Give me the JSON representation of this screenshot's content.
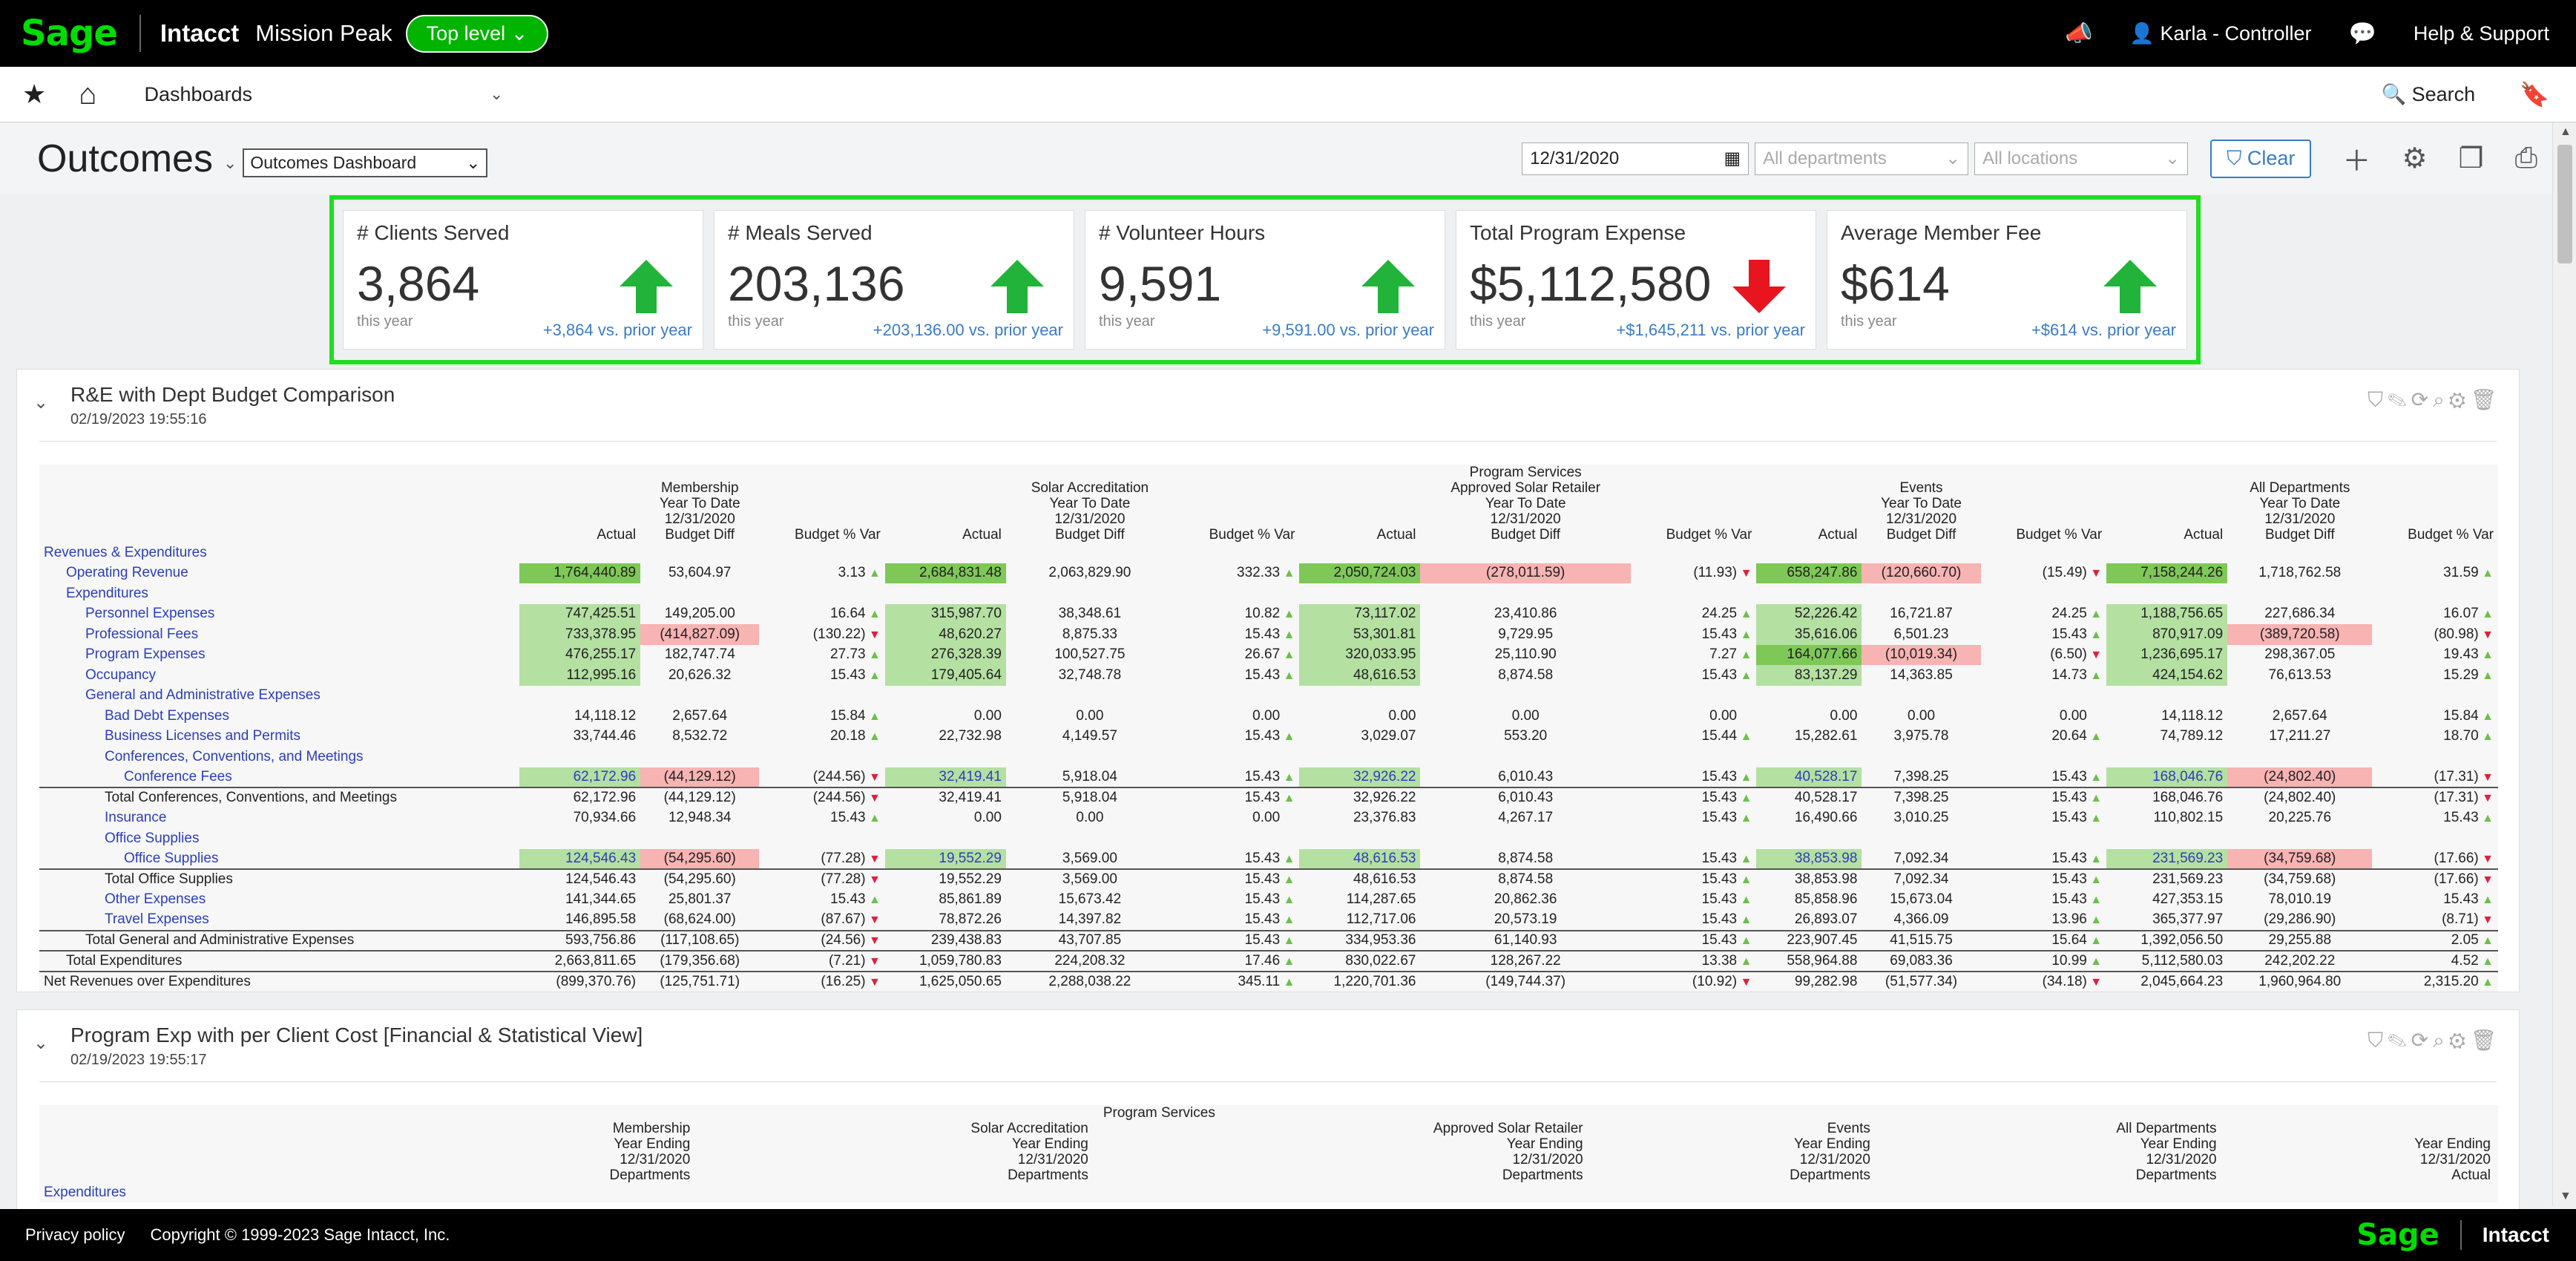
{
  "topbar": {
    "logo": "Sage",
    "brand": "Intacct",
    "company": "Mission Peak",
    "level": "Top level",
    "user": "Karla - Controller",
    "help": "Help & Support"
  },
  "navbar": {
    "menu": "Dashboards",
    "search": "Search"
  },
  "page": {
    "title": "Outcomes",
    "dashboard_select": "Outcomes Dashboard",
    "date": "12/31/2020",
    "departments_placeholder": "All departments",
    "locations_placeholder": "All locations",
    "clear": "Clear"
  },
  "kpis": [
    {
      "title": "# Clients Served",
      "value": "3,864",
      "sub": "this year",
      "change": "+3,864 vs. prior year",
      "trend": "up"
    },
    {
      "title": "# Meals Served",
      "value": "203,136",
      "sub": "this year",
      "change": "+203,136.00 vs. prior year",
      "trend": "up"
    },
    {
      "title": "# Volunteer Hours",
      "value": "9,591",
      "sub": "this year",
      "change": "+9,591.00 vs. prior year",
      "trend": "up"
    },
    {
      "title": "Total Program Expense",
      "value": "$5,112,580",
      "sub": "this year",
      "change": "+$1,645,211 vs. prior year",
      "trend": "down"
    },
    {
      "title": "Average Member Fee",
      "value": "$614",
      "sub": "this year",
      "change": "+$614 vs. prior year",
      "trend": "up"
    }
  ],
  "colors": {
    "up": "#22b33a",
    "down": "#e8141e",
    "highlight": "#22dd22",
    "link": "#3a7cc5"
  },
  "report1": {
    "title": "R&E with Dept Budget Comparison",
    "timestamp": "02/19/2023 19:55:16",
    "groups": [
      {
        "h": [
          "Membership",
          "Year To Date",
          "12/31/2020"
        ]
      },
      {
        "h": [
          "Solar Accreditation",
          "Year To Date",
          "12/31/2020"
        ]
      },
      {
        "h": [
          "Program Services",
          "Approved Solar Retailer",
          "Year To Date",
          "12/31/2020"
        ]
      },
      {
        "h": [
          "Events",
          "Year To Date",
          "12/31/2020"
        ]
      },
      {
        "h": [
          "All Departments",
          "Year To Date",
          "12/31/2020"
        ]
      }
    ],
    "col_actual": "Actual",
    "col_diff": "Budget Diff",
    "col_pct": "Budget % Var",
    "rows": [
      {
        "label": "Revenues & Expenditures",
        "indent": 0,
        "blue": true,
        "cells": []
      },
      {
        "label": "Operating Revenue",
        "indent": 1,
        "blue": true,
        "cells": [
          [
            "1,764,440.89",
            "53,604.97",
            "3.13",
            "up",
            "gd",
            ""
          ],
          [
            "2,684,831.48",
            "2,063,829.90",
            "332.33",
            "up",
            "gd",
            ""
          ],
          [
            "2,050,724.03",
            "(278,011.59)",
            "(11.93)",
            "dn",
            "gd",
            "r"
          ],
          [
            "658,247.86",
            "(120,660.70)",
            "(15.49)",
            "dn",
            "gd",
            "r"
          ],
          [
            "7,158,244.26",
            "1,718,762.58",
            "31.59",
            "up",
            "gd",
            ""
          ]
        ]
      },
      {
        "label": "Expenditures",
        "indent": 1,
        "blue": true,
        "cells": []
      },
      {
        "label": "Personnel Expenses",
        "indent": 2,
        "blue": true,
        "cells": [
          [
            "747,425.51",
            "149,205.00",
            "16.64",
            "up",
            "g",
            ""
          ],
          [
            "315,987.70",
            "38,348.61",
            "10.82",
            "up",
            "g",
            ""
          ],
          [
            "73,117.02",
            "23,410.86",
            "24.25",
            "up",
            "g",
            ""
          ],
          [
            "52,226.42",
            "16,721.87",
            "24.25",
            "up",
            "g",
            ""
          ],
          [
            "1,188,756.65",
            "227,686.34",
            "16.07",
            "up",
            "g",
            ""
          ]
        ]
      },
      {
        "label": "Professional Fees",
        "indent": 2,
        "blue": true,
        "cells": [
          [
            "733,378.95",
            "(414,827.09)",
            "(130.22)",
            "dn",
            "g",
            "r"
          ],
          [
            "48,620.27",
            "8,875.33",
            "15.43",
            "up",
            "g",
            ""
          ],
          [
            "53,301.81",
            "9,729.95",
            "15.43",
            "up",
            "g",
            ""
          ],
          [
            "35,616.06",
            "6,501.23",
            "15.43",
            "up",
            "g",
            ""
          ],
          [
            "870,917.09",
            "(389,720.58)",
            "(80.98)",
            "dn",
            "g",
            "r"
          ]
        ]
      },
      {
        "label": "Program Expenses",
        "indent": 2,
        "blue": true,
        "cells": [
          [
            "476,255.17",
            "182,747.74",
            "27.73",
            "up",
            "g",
            ""
          ],
          [
            "276,328.39",
            "100,527.75",
            "26.67",
            "up",
            "g",
            ""
          ],
          [
            "320,033.95",
            "25,110.90",
            "7.27",
            "up",
            "g",
            ""
          ],
          [
            "164,077.66",
            "(10,019.34)",
            "(6.50)",
            "dn",
            "gd",
            "r"
          ],
          [
            "1,236,695.17",
            "298,367.05",
            "19.43",
            "up",
            "g",
            ""
          ]
        ]
      },
      {
        "label": "Occupancy",
        "indent": 2,
        "blue": true,
        "cells": [
          [
            "112,995.16",
            "20,626.32",
            "15.43",
            "up",
            "g",
            ""
          ],
          [
            "179,405.64",
            "32,748.78",
            "15.43",
            "up",
            "g",
            ""
          ],
          [
            "48,616.53",
            "8,874.58",
            "15.43",
            "up",
            "g",
            ""
          ],
          [
            "83,137.29",
            "14,363.85",
            "14.73",
            "up",
            "g",
            ""
          ],
          [
            "424,154.62",
            "76,613.53",
            "15.29",
            "up",
            "g",
            ""
          ]
        ]
      },
      {
        "label": "General and Administrative Expenses",
        "indent": 2,
        "blue": true,
        "cells": []
      },
      {
        "label": "Bad Debt Expenses",
        "indent": 3,
        "blue": true,
        "cells": [
          [
            "14,118.12",
            "2,657.64",
            "15.84",
            "up",
            "",
            ""
          ],
          [
            "0.00",
            "0.00",
            "0.00",
            "",
            "",
            ""
          ],
          [
            "0.00",
            "0.00",
            "0.00",
            "",
            "",
            ""
          ],
          [
            "0.00",
            "0.00",
            "0.00",
            "",
            "",
            ""
          ],
          [
            "14,118.12",
            "2,657.64",
            "15.84",
            "up",
            "",
            ""
          ]
        ]
      },
      {
        "label": "Business Licenses and Permits",
        "indent": 3,
        "blue": true,
        "cells": [
          [
            "33,744.46",
            "8,532.72",
            "20.18",
            "up",
            "",
            ""
          ],
          [
            "22,732.98",
            "4,149.57",
            "15.43",
            "up",
            "",
            ""
          ],
          [
            "3,029.07",
            "553.20",
            "15.44",
            "up",
            "",
            ""
          ],
          [
            "15,282.61",
            "3,975.78",
            "20.64",
            "up",
            "",
            ""
          ],
          [
            "74,789.12",
            "17,211.27",
            "18.70",
            "up",
            "",
            ""
          ]
        ]
      },
      {
        "label": "Conferences, Conventions, and Meetings",
        "indent": 3,
        "blue": true,
        "cells": []
      },
      {
        "label": "Conference Fees",
        "indent": 4,
        "blue": true,
        "cells": [
          [
            "62,172.96",
            "(44,129.12)",
            "(244.56)",
            "dn",
            "gb",
            "r"
          ],
          [
            "32,419.41",
            "5,918.04",
            "15.43",
            "up",
            "gb",
            ""
          ],
          [
            "32,926.22",
            "6,010.43",
            "15.43",
            "up",
            "gb",
            ""
          ],
          [
            "40,528.17",
            "7,398.25",
            "15.43",
            "up",
            "gb",
            ""
          ],
          [
            "168,046.76",
            "(24,802.40)",
            "(17.31)",
            "dn",
            "gb",
            "r"
          ]
        ]
      },
      {
        "label": "Total Conferences, Conventions, and Meetings",
        "indent": 3,
        "blue": false,
        "total": true,
        "cells": [
          [
            "62,172.96",
            "(44,129.12)",
            "(244.56)",
            "dn",
            "",
            ""
          ],
          [
            "32,419.41",
            "5,918.04",
            "15.43",
            "up",
            "",
            ""
          ],
          [
            "32,926.22",
            "6,010.43",
            "15.43",
            "up",
            "",
            ""
          ],
          [
            "40,528.17",
            "7,398.25",
            "15.43",
            "up",
            "",
            ""
          ],
          [
            "168,046.76",
            "(24,802.40)",
            "(17.31)",
            "dn",
            "",
            ""
          ]
        ]
      },
      {
        "label": "Insurance",
        "indent": 3,
        "blue": true,
        "cells": [
          [
            "70,934.66",
            "12,948.34",
            "15.43",
            "up",
            "",
            ""
          ],
          [
            "0.00",
            "0.00",
            "0.00",
            "",
            "",
            ""
          ],
          [
            "23,376.83",
            "4,267.17",
            "15.43",
            "up",
            "",
            ""
          ],
          [
            "16,490.66",
            "3,010.25",
            "15.43",
            "up",
            "",
            ""
          ],
          [
            "110,802.15",
            "20,225.76",
            "15.43",
            "up",
            "",
            ""
          ]
        ]
      },
      {
        "label": "Office Supplies",
        "indent": 3,
        "blue": true,
        "cells": []
      },
      {
        "label": "Office Supplies",
        "indent": 4,
        "blue": true,
        "cells": [
          [
            "124,546.43",
            "(54,295.60)",
            "(77.28)",
            "dn",
            "gb",
            "r"
          ],
          [
            "19,552.29",
            "3,569.00",
            "15.43",
            "up",
            "gb",
            ""
          ],
          [
            "48,616.53",
            "8,874.58",
            "15.43",
            "up",
            "gb",
            ""
          ],
          [
            "38,853.98",
            "7,092.34",
            "15.43",
            "up",
            "gb",
            ""
          ],
          [
            "231,569.23",
            "(34,759.68)",
            "(17.66)",
            "dn",
            "gb",
            "r"
          ]
        ]
      },
      {
        "label": "Total Office Supplies",
        "indent": 3,
        "blue": false,
        "total": true,
        "cells": [
          [
            "124,546.43",
            "(54,295.60)",
            "(77.28)",
            "dn",
            "",
            ""
          ],
          [
            "19,552.29",
            "3,569.00",
            "15.43",
            "up",
            "",
            ""
          ],
          [
            "48,616.53",
            "8,874.58",
            "15.43",
            "up",
            "",
            ""
          ],
          [
            "38,853.98",
            "7,092.34",
            "15.43",
            "up",
            "",
            ""
          ],
          [
            "231,569.23",
            "(34,759.68)",
            "(17.66)",
            "dn",
            "",
            ""
          ]
        ]
      },
      {
        "label": "Other Expenses",
        "indent": 3,
        "blue": true,
        "cells": [
          [
            "141,344.65",
            "25,801.37",
            "15.43",
            "up",
            "",
            ""
          ],
          [
            "85,861.89",
            "15,673.42",
            "15.43",
            "up",
            "",
            ""
          ],
          [
            "114,287.65",
            "20,862.36",
            "15.43",
            "up",
            "",
            ""
          ],
          [
            "85,858.96",
            "15,673.04",
            "15.43",
            "up",
            "",
            ""
          ],
          [
            "427,353.15",
            "78,010.19",
            "15.43",
            "up",
            "",
            ""
          ]
        ]
      },
      {
        "label": "Travel Expenses",
        "indent": 3,
        "blue": true,
        "cells": [
          [
            "146,895.58",
            "(68,624.00)",
            "(87.67)",
            "dn",
            "",
            ""
          ],
          [
            "78,872.26",
            "14,397.82",
            "15.43",
            "up",
            "",
            ""
          ],
          [
            "112,717.06",
            "20,573.19",
            "15.43",
            "up",
            "",
            ""
          ],
          [
            "26,893.07",
            "4,366.09",
            "13.96",
            "up",
            "",
            ""
          ],
          [
            "365,377.97",
            "(29,286.90)",
            "(8.71)",
            "dn",
            "",
            ""
          ]
        ]
      },
      {
        "label": "Total General and Administrative Expenses",
        "indent": 2,
        "blue": false,
        "total": true,
        "cells": [
          [
            "593,756.86",
            "(117,108.65)",
            "(24.56)",
            "dn",
            "",
            ""
          ],
          [
            "239,438.83",
            "43,707.85",
            "15.43",
            "up",
            "",
            ""
          ],
          [
            "334,953.36",
            "61,140.93",
            "15.43",
            "up",
            "",
            ""
          ],
          [
            "223,907.45",
            "41,515.75",
            "15.64",
            "up",
            "",
            ""
          ],
          [
            "1,392,056.50",
            "29,255.88",
            "2.05",
            "up",
            "",
            ""
          ]
        ]
      },
      {
        "label": "Total Expenditures",
        "indent": 1,
        "blue": false,
        "total": true,
        "cells": [
          [
            "2,663,811.65",
            "(179,356.68)",
            "(7.21)",
            "dn",
            "",
            ""
          ],
          [
            "1,059,780.83",
            "224,208.32",
            "17.46",
            "up",
            "",
            ""
          ],
          [
            "830,022.67",
            "128,267.22",
            "13.38",
            "up",
            "",
            ""
          ],
          [
            "558,964.88",
            "69,083.36",
            "10.99",
            "up",
            "",
            ""
          ],
          [
            "5,112,580.03",
            "242,202.22",
            "4.52",
            "up",
            "",
            ""
          ]
        ]
      },
      {
        "label": "Net Revenues over Expenditures",
        "indent": 0,
        "blue": false,
        "total": true,
        "cells": [
          [
            "(899,370.76)",
            "(125,751.71)",
            "(16.25)",
            "dn",
            "",
            ""
          ],
          [
            "1,625,050.65",
            "2,288,038.22",
            "345.11",
            "up",
            "",
            ""
          ],
          [
            "1,220,701.36",
            "(149,744.37)",
            "(10.92)",
            "dn",
            "",
            ""
          ],
          [
            "99,282.98",
            "(51,577.34)",
            "(34.18)",
            "dn",
            "",
            ""
          ],
          [
            "2,045,664.23",
            "1,960,964.80",
            "2,315.20",
            "up",
            "",
            ""
          ]
        ]
      }
    ]
  },
  "report2": {
    "title": "Program Exp with per Client Cost [Financial & Statistical View]",
    "timestamp": "02/19/2023 19:55:17",
    "group_header": "Program Services",
    "cols": [
      [
        "Membership",
        "Year Ending",
        "12/31/2020",
        "Departments"
      ],
      [
        "Solar Accreditation",
        "Year Ending",
        "12/31/2020",
        "Departments"
      ],
      [
        "Approved Solar Retailer",
        "Year Ending",
        "12/31/2020",
        "Departments"
      ],
      [
        "Events",
        "Year Ending",
        "12/31/2020",
        "Departments"
      ],
      [
        "All Departments",
        "Year Ending",
        "12/31/2020",
        "Departments"
      ],
      [
        "Year Ending",
        "12/31/2020",
        "Actual"
      ]
    ],
    "first_row": "Expenditures"
  },
  "footer": {
    "privacy": "Privacy policy",
    "copyright": "Copyright © 1999-2023 Sage Intacct, Inc.",
    "logo": "Sage",
    "brand": "Intacct"
  }
}
